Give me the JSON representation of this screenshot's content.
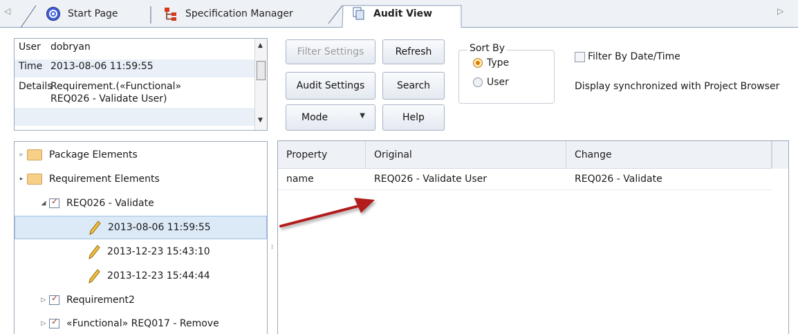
{
  "tabs": {
    "items": [
      {
        "label": "Start Page",
        "icon": "start-page-icon"
      },
      {
        "label": "Specification Manager",
        "icon": "specification-icon"
      },
      {
        "label": "Audit View",
        "icon": "audit-view-icon",
        "active": true
      }
    ],
    "left_arrow": "◁",
    "right_arrow": "▷"
  },
  "info": {
    "user_label": "User",
    "user_value": "dobryan",
    "time_label": "Time",
    "time_value": "2013-08-06 11:59:55",
    "details_label": "Details",
    "details_line1": "Requirement.(«Functional»",
    "details_line2": "REQ026 - Validate User)"
  },
  "toolbar": {
    "filter_settings": "Filter Settings",
    "refresh": "Refresh",
    "audit_settings": "Audit Settings",
    "search": "Search",
    "mode": "Mode",
    "help": "Help"
  },
  "sort_by": {
    "legend": "Sort By",
    "options": [
      "Type",
      "User"
    ],
    "selected": "Type"
  },
  "filter_by_date": {
    "label": "Filter By Date/Time",
    "checked": false
  },
  "sync_note": "Display synchronized with Project Browser",
  "tree": {
    "nodes": [
      {
        "label": "Package Elements"
      },
      {
        "label": "Requirement Elements"
      },
      {
        "label": "REQ026 - Validate"
      },
      {
        "label": "2013-08-06 11:59:55",
        "selected": true
      },
      {
        "label": "2013-12-23 15:43:10"
      },
      {
        "label": "2013-12-23 15:44:44"
      },
      {
        "label": "Requirement2"
      },
      {
        "label": "«Functional» REQ017 - Remove"
      }
    ]
  },
  "grid": {
    "columns": [
      "Property",
      "Original",
      "Change"
    ],
    "rows": [
      [
        "name",
        "REQ026 - Validate User",
        "REQ026 - Validate"
      ]
    ]
  },
  "colors": {
    "arrow": "#b21e1e",
    "selection": "#dce9f7",
    "folder": "#f7cf86"
  }
}
